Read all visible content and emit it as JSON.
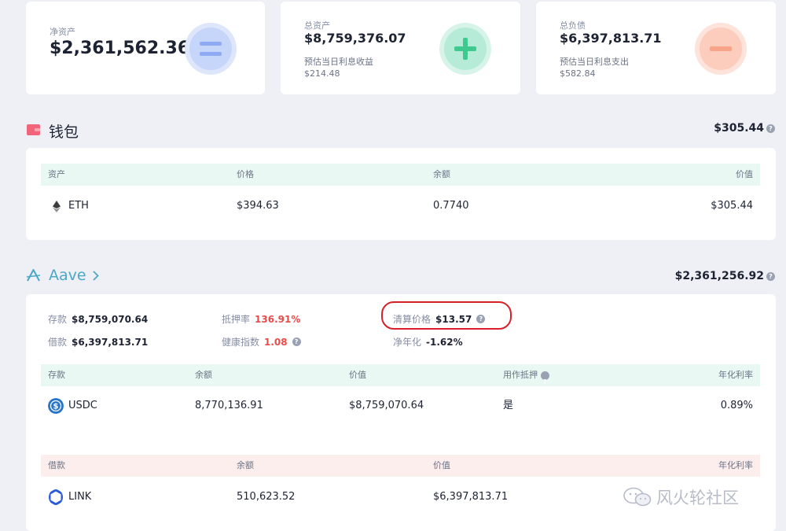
{
  "summary": {
    "net": {
      "label": "净资产",
      "value": "$2,361,562.36",
      "symbol": "="
    },
    "assets": {
      "label": "总资产",
      "value": "$8,759,376.07",
      "sub_label": "预估当日利息收益",
      "sub_value": "$214.48",
      "symbol": "+"
    },
    "debts": {
      "label": "总负债",
      "value": "$6,397,813.71",
      "sub_label": "预估当日利息支出",
      "sub_value": "$582.84",
      "symbol": "−"
    }
  },
  "wallet": {
    "title": "钱包",
    "total": "$305.44",
    "headers": {
      "asset": "资产",
      "price": "价格",
      "balance": "余额",
      "value": "价值"
    },
    "rows": [
      {
        "asset": "ETH",
        "price": "$394.63",
        "balance": "0.7740",
        "value": "$305.44"
      }
    ]
  },
  "aave": {
    "title": "Aave",
    "total": "$2,361,256.92",
    "stats": {
      "deposit_label": "存款",
      "deposit_value": "$8,759,070.64",
      "borrow_label": "借款",
      "borrow_value": "$6,397,813.71",
      "collateral_ratio_label": "抵押率",
      "collateral_ratio_value": "136.91%",
      "health_label": "健康指数",
      "health_value": "1.08",
      "liquidation_label": "清算价格",
      "liquidation_value": "$13.57",
      "apy_label": "净年化",
      "apy_value": "-1.62%"
    },
    "deposit_table": {
      "headers": {
        "name": "存款",
        "balance": "余额",
        "value": "价值",
        "collateral": "用作抵押",
        "rate": "年化利率"
      },
      "rows": [
        {
          "asset": "USDC",
          "balance": "8,770,136.91",
          "value": "$8,759,070.64",
          "collateral": "是",
          "rate": "0.89%"
        }
      ]
    },
    "borrow_table": {
      "headers": {
        "name": "借款",
        "balance": "余额",
        "value": "价值",
        "rate": "年化利率"
      },
      "rows": [
        {
          "asset": "LINK",
          "balance": "510,623.52",
          "value": "$6,397,813.71"
        }
      ]
    }
  },
  "watermark": {
    "text": "风火轮社区"
  },
  "colors": {
    "wallet_icon": "#f2647a",
    "aave_accent": "#4aa7c8",
    "green_header": "#eaf8f4",
    "pink_header": "#fdeeee",
    "highlight_ring": "#d9202a",
    "negative": "#e94a4a"
  }
}
